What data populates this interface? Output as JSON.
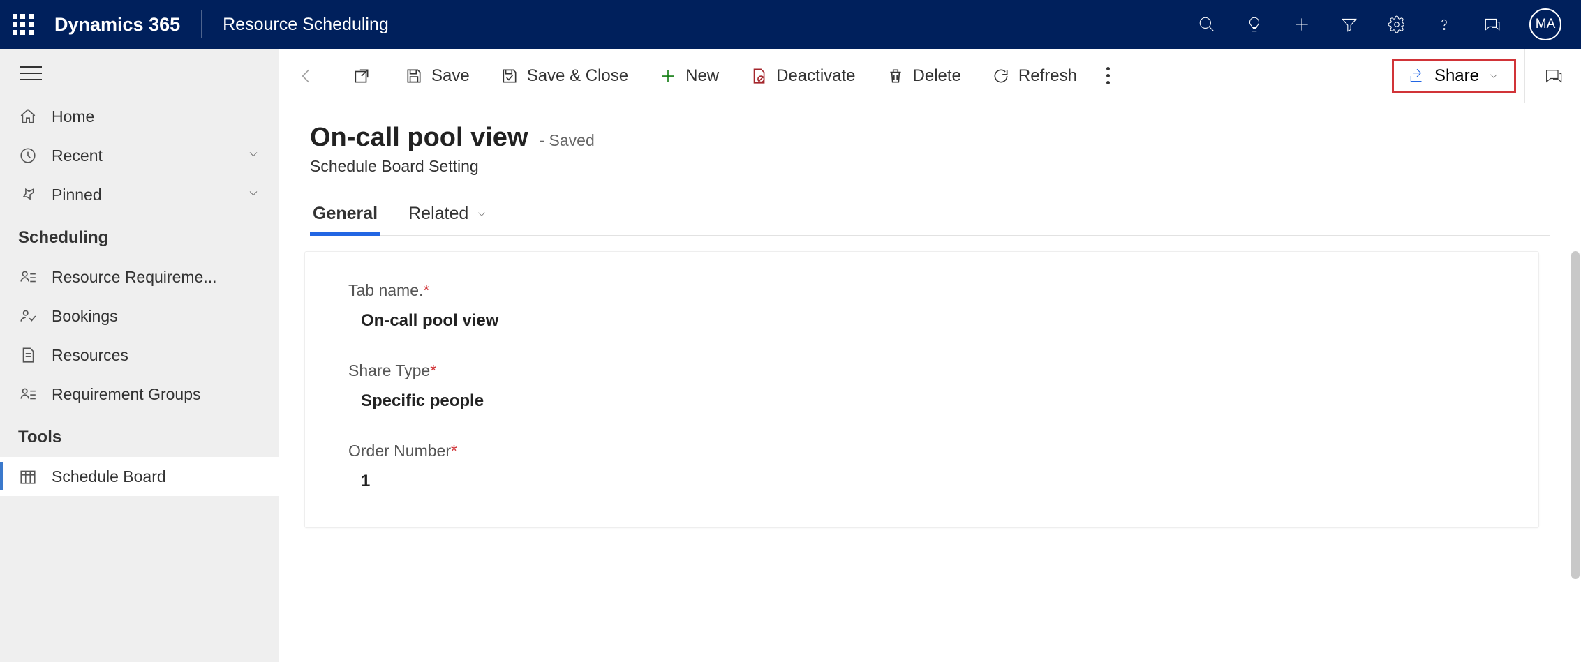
{
  "navbar": {
    "product": "Dynamics 365",
    "app": "Resource Scheduling",
    "avatar": "MA"
  },
  "sidebar": {
    "home": "Home",
    "recent": "Recent",
    "pinned": "Pinned",
    "section_scheduling": "Scheduling",
    "resource_requirements": "Resource Requireme...",
    "bookings": "Bookings",
    "resources": "Resources",
    "requirement_groups": "Requirement Groups",
    "section_tools": "Tools",
    "schedule_board": "Schedule Board"
  },
  "commands": {
    "save": "Save",
    "save_close": "Save & Close",
    "new": "New",
    "deactivate": "Deactivate",
    "delete": "Delete",
    "refresh": "Refresh",
    "share": "Share"
  },
  "record": {
    "title": "On-call pool view",
    "status": "- Saved",
    "entity": "Schedule Board Setting"
  },
  "tabs": {
    "general": "General",
    "related": "Related"
  },
  "form": {
    "tab_name_label": "Tab name.",
    "tab_name_value": "On-call pool view",
    "share_type_label": "Share Type",
    "share_type_value": "Specific people",
    "order_number_label": "Order Number",
    "order_number_value": "1"
  }
}
